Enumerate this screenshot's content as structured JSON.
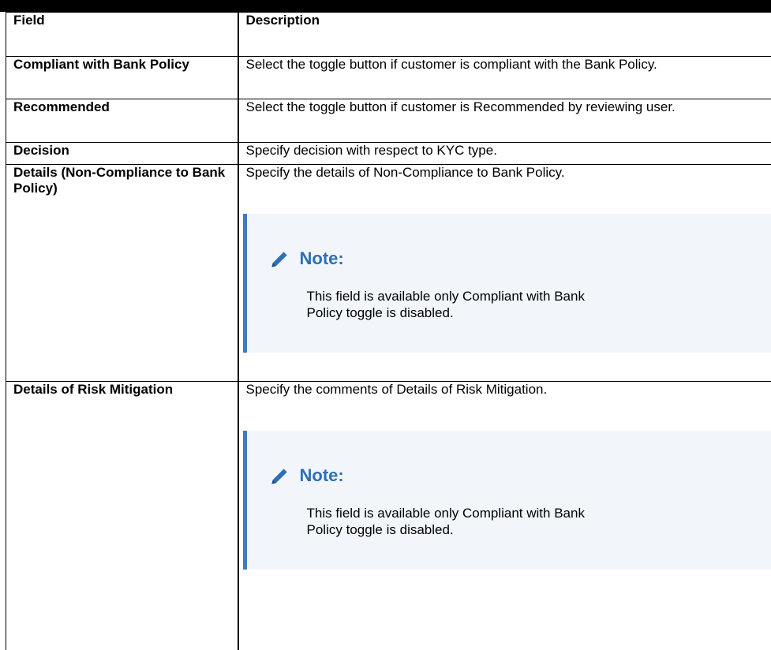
{
  "table": {
    "headers": {
      "field": "Field",
      "description": "Description"
    },
    "rows": [
      {
        "field": "Compliant with Bank Policy",
        "description": "Select the toggle button if customer is compliant with the Bank Policy."
      },
      {
        "field": "Recommended",
        "description": "Select the toggle button if customer is Recommended by reviewing user."
      },
      {
        "field": "Decision",
        "description": "Specify decision with respect to KYC type."
      },
      {
        "field": "Details (Non-Compliance to Bank Policy)",
        "description": "Specify the details of Non-Compliance to Bank Policy.",
        "note": {
          "title": "Note:",
          "icon": "pencil-icon",
          "text": "This field is available only Compliant with Bank Policy toggle is disabled."
        }
      },
      {
        "field": "Details of Risk Mitigation",
        "description": "Specify the comments of Details of Risk Mitigation.",
        "note": {
          "title": "Note:",
          "icon": "pencil-icon",
          "text": "This field is available only Compliant with Bank Policy toggle is disabled."
        }
      }
    ]
  },
  "colors": {
    "note_background": "#f2f6fb",
    "note_accent": "#3f7bbf",
    "note_title": "#2e6fb5"
  }
}
